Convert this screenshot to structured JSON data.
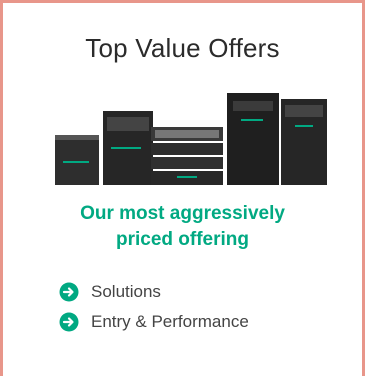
{
  "card": {
    "title": "Top Value Offers",
    "image_alt": "server-lineup-image",
    "tagline_line1": "Our most aggressively",
    "tagline_line2": "priced offering",
    "links": [
      {
        "label": "Solutions",
        "icon": "arrow-circle-right-icon"
      },
      {
        "label": "Entry & Performance",
        "icon": "arrow-circle-right-icon"
      }
    ]
  },
  "colors": {
    "accent_green": "#01a982",
    "border": "#e8968a",
    "text": "#2b2b2b"
  }
}
